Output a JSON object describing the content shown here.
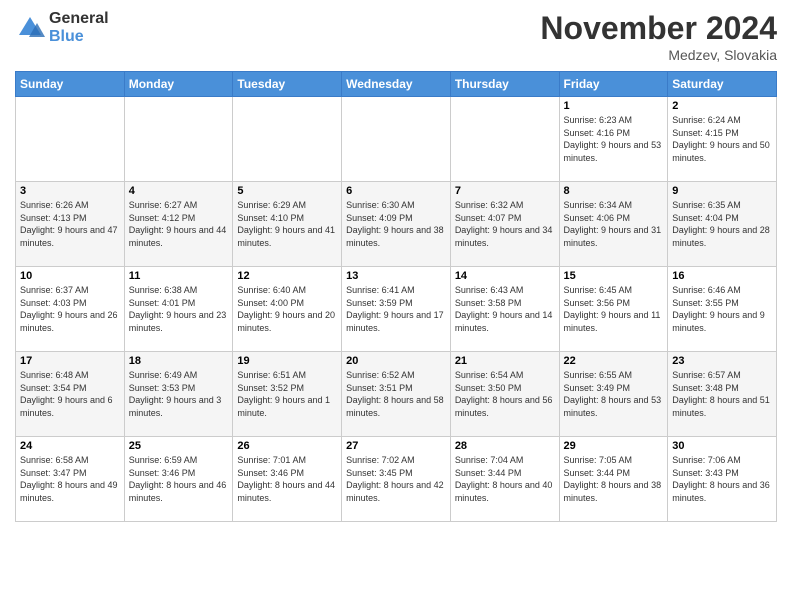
{
  "header": {
    "logo_general": "General",
    "logo_blue": "Blue",
    "month_title": "November 2024",
    "location": "Medzev, Slovakia"
  },
  "days_of_week": [
    "Sunday",
    "Monday",
    "Tuesday",
    "Wednesday",
    "Thursday",
    "Friday",
    "Saturday"
  ],
  "weeks": [
    [
      {
        "day": "",
        "info": ""
      },
      {
        "day": "",
        "info": ""
      },
      {
        "day": "",
        "info": ""
      },
      {
        "day": "",
        "info": ""
      },
      {
        "day": "",
        "info": ""
      },
      {
        "day": "1",
        "info": "Sunrise: 6:23 AM\nSunset: 4:16 PM\nDaylight: 9 hours and 53 minutes."
      },
      {
        "day": "2",
        "info": "Sunrise: 6:24 AM\nSunset: 4:15 PM\nDaylight: 9 hours and 50 minutes."
      }
    ],
    [
      {
        "day": "3",
        "info": "Sunrise: 6:26 AM\nSunset: 4:13 PM\nDaylight: 9 hours and 47 minutes."
      },
      {
        "day": "4",
        "info": "Sunrise: 6:27 AM\nSunset: 4:12 PM\nDaylight: 9 hours and 44 minutes."
      },
      {
        "day": "5",
        "info": "Sunrise: 6:29 AM\nSunset: 4:10 PM\nDaylight: 9 hours and 41 minutes."
      },
      {
        "day": "6",
        "info": "Sunrise: 6:30 AM\nSunset: 4:09 PM\nDaylight: 9 hours and 38 minutes."
      },
      {
        "day": "7",
        "info": "Sunrise: 6:32 AM\nSunset: 4:07 PM\nDaylight: 9 hours and 34 minutes."
      },
      {
        "day": "8",
        "info": "Sunrise: 6:34 AM\nSunset: 4:06 PM\nDaylight: 9 hours and 31 minutes."
      },
      {
        "day": "9",
        "info": "Sunrise: 6:35 AM\nSunset: 4:04 PM\nDaylight: 9 hours and 28 minutes."
      }
    ],
    [
      {
        "day": "10",
        "info": "Sunrise: 6:37 AM\nSunset: 4:03 PM\nDaylight: 9 hours and 26 minutes."
      },
      {
        "day": "11",
        "info": "Sunrise: 6:38 AM\nSunset: 4:01 PM\nDaylight: 9 hours and 23 minutes."
      },
      {
        "day": "12",
        "info": "Sunrise: 6:40 AM\nSunset: 4:00 PM\nDaylight: 9 hours and 20 minutes."
      },
      {
        "day": "13",
        "info": "Sunrise: 6:41 AM\nSunset: 3:59 PM\nDaylight: 9 hours and 17 minutes."
      },
      {
        "day": "14",
        "info": "Sunrise: 6:43 AM\nSunset: 3:58 PM\nDaylight: 9 hours and 14 minutes."
      },
      {
        "day": "15",
        "info": "Sunrise: 6:45 AM\nSunset: 3:56 PM\nDaylight: 9 hours and 11 minutes."
      },
      {
        "day": "16",
        "info": "Sunrise: 6:46 AM\nSunset: 3:55 PM\nDaylight: 9 hours and 9 minutes."
      }
    ],
    [
      {
        "day": "17",
        "info": "Sunrise: 6:48 AM\nSunset: 3:54 PM\nDaylight: 9 hours and 6 minutes."
      },
      {
        "day": "18",
        "info": "Sunrise: 6:49 AM\nSunset: 3:53 PM\nDaylight: 9 hours and 3 minutes."
      },
      {
        "day": "19",
        "info": "Sunrise: 6:51 AM\nSunset: 3:52 PM\nDaylight: 9 hours and 1 minute."
      },
      {
        "day": "20",
        "info": "Sunrise: 6:52 AM\nSunset: 3:51 PM\nDaylight: 8 hours and 58 minutes."
      },
      {
        "day": "21",
        "info": "Sunrise: 6:54 AM\nSunset: 3:50 PM\nDaylight: 8 hours and 56 minutes."
      },
      {
        "day": "22",
        "info": "Sunrise: 6:55 AM\nSunset: 3:49 PM\nDaylight: 8 hours and 53 minutes."
      },
      {
        "day": "23",
        "info": "Sunrise: 6:57 AM\nSunset: 3:48 PM\nDaylight: 8 hours and 51 minutes."
      }
    ],
    [
      {
        "day": "24",
        "info": "Sunrise: 6:58 AM\nSunset: 3:47 PM\nDaylight: 8 hours and 49 minutes."
      },
      {
        "day": "25",
        "info": "Sunrise: 6:59 AM\nSunset: 3:46 PM\nDaylight: 8 hours and 46 minutes."
      },
      {
        "day": "26",
        "info": "Sunrise: 7:01 AM\nSunset: 3:46 PM\nDaylight: 8 hours and 44 minutes."
      },
      {
        "day": "27",
        "info": "Sunrise: 7:02 AM\nSunset: 3:45 PM\nDaylight: 8 hours and 42 minutes."
      },
      {
        "day": "28",
        "info": "Sunrise: 7:04 AM\nSunset: 3:44 PM\nDaylight: 8 hours and 40 minutes."
      },
      {
        "day": "29",
        "info": "Sunrise: 7:05 AM\nSunset: 3:44 PM\nDaylight: 8 hours and 38 minutes."
      },
      {
        "day": "30",
        "info": "Sunrise: 7:06 AM\nSunset: 3:43 PM\nDaylight: 8 hours and 36 minutes."
      }
    ]
  ]
}
